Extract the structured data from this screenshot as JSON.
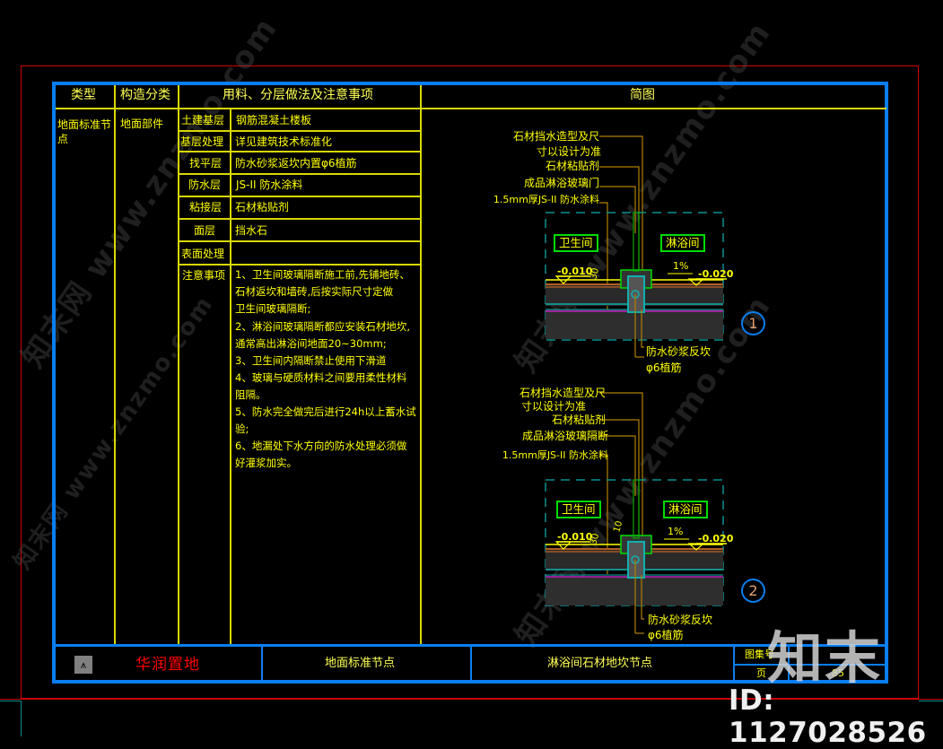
{
  "table_header": {
    "col1": "类型",
    "col2": "构造分类",
    "col3": "用料、分层做法及注意事项",
    "col4": "简图"
  },
  "type_value": "地面标准节点",
  "category_value": "地面部件",
  "layers": [
    {
      "name": "土建基层",
      "value": "钢筋混凝土楼板"
    },
    {
      "name": "基层处理",
      "value": "详见建筑技术标准化"
    },
    {
      "name": "找平层",
      "value": "防水砂浆返坎内置φ6植筋"
    },
    {
      "name": "防水层",
      "value": "JS-II 防水涂料"
    },
    {
      "name": "粘接层",
      "value": "石材粘贴剂"
    },
    {
      "name": "面层",
      "value": "挡水石"
    },
    {
      "name": "表面处理",
      "value": ""
    }
  ],
  "notes_label": "注意事项",
  "notes": [
    "1、卫生间玻璃隔断施工前,先铺地砖、",
    "    石材返坎和墙砖,后按实际尺寸定做",
    "    卫生间玻璃隔断;",
    "2、淋浴间玻璃隔断都应安装石材地坎,",
    "    通常高出淋浴间地面20~30mm;",
    "3、卫生间内隔断禁止使用下滑道",
    "4、玻璃与硬质材料之间要用柔性材料",
    "    阻隔。",
    "5、防水完全做完后进行24h以上蓄水试",
    "    验;",
    "6、地漏处下水方向的防水处理必须做",
    "    好灌浆加实。"
  ],
  "diagram1": {
    "labels": [
      "石材挡水造型及尺",
      "寸以设计为准",
      "石材粘贴剂",
      "成品淋浴玻璃门",
      "1.5mm厚JS-II 防水涂料"
    ],
    "room_left": "卫生间",
    "room_right": "淋浴间",
    "level_left": "-0.010",
    "level_right": "-0.020",
    "slope": "1%",
    "dim": "30",
    "bottom_labels": [
      "防水砂浆反坎",
      "φ6植筋"
    ],
    "number": "1"
  },
  "diagram2": {
    "labels": [
      "石材挡水造型及尺",
      "寸以设计为准",
      "石材粘贴剂",
      "成品淋浴玻璃隔断",
      "1.5mm厚JS-II 防水涂料"
    ],
    "room_left": "卫生间",
    "room_right": "淋浴间",
    "level_left": "-0.010",
    "level_right": "-0.020",
    "slope": "1%",
    "dim": "30",
    "dim2": "10",
    "bottom_labels": [
      "防水砂浆反坎",
      "φ6植筋"
    ],
    "number": "2"
  },
  "title_block": {
    "company": "华润置地",
    "section": "地面标准节点",
    "drawing_name": "淋浴间石材地坎节点",
    "atlas_label": "图集号",
    "atlas_value": "",
    "page_label": "页",
    "page_value": "85"
  },
  "colors": {
    "frame_blue": "#0a7ef0",
    "table_yellow": "#d8d800",
    "text_yellow": "#ffff00",
    "border_red": "#d40000",
    "company_red": "#ff0000",
    "room_green": "#00dd00"
  },
  "watermark": {
    "brand": "知末",
    "id_text": "ID: 1127028526",
    "site": "知末网 www.znzmo.com"
  }
}
